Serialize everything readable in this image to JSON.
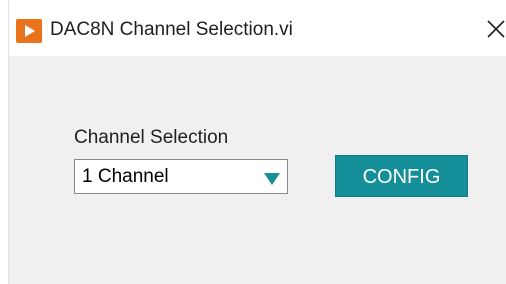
{
  "window": {
    "title": "DAC8N Channel Selection.vi",
    "app_icon": "labview-play-icon",
    "close_icon": "close-icon",
    "close_symbol": "✕"
  },
  "form": {
    "channel_label": "Channel Selection",
    "channel_select": {
      "selected": "1 Channel",
      "arrow_color": "#148e98"
    },
    "config_button": "CONFIG"
  },
  "colors": {
    "accent": "#148e98",
    "app_icon": "#e8731b",
    "background": "#f0f0f0"
  }
}
